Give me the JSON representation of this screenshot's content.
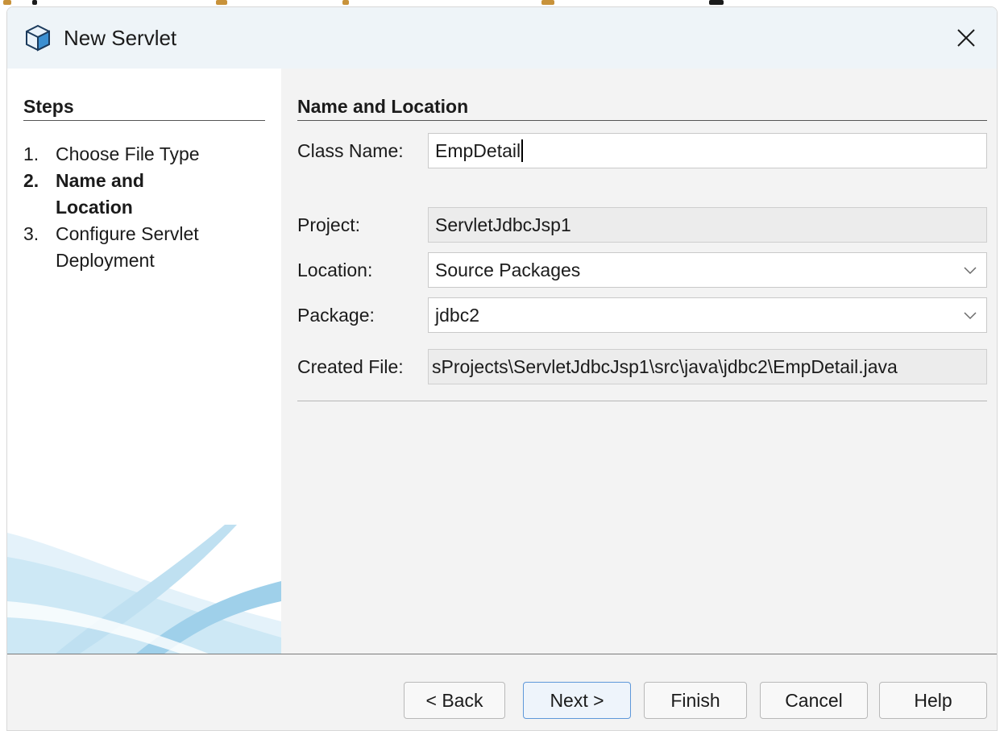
{
  "window": {
    "title": "New Servlet"
  },
  "steps": {
    "title": "Steps",
    "items": [
      {
        "num": "1.",
        "label": "Choose File Type",
        "active": false
      },
      {
        "num": "2.",
        "label": "Name and Location",
        "active": true
      },
      {
        "num": "3.",
        "label": "Configure Servlet Deployment",
        "active": false
      }
    ]
  },
  "panel": {
    "title": "Name and Location",
    "class_name": {
      "label": "Class Name:",
      "value": "EmpDetail"
    },
    "project": {
      "label": "Project:",
      "value": "ServletJdbcJsp1"
    },
    "location": {
      "label": "Location:",
      "value": "Source Packages"
    },
    "package": {
      "label": "Package:",
      "value": "jdbc2"
    },
    "created_file": {
      "label": "Created File:",
      "value": "sProjects\\ServletJdbcJsp1\\src\\java\\jdbc2\\EmpDetail.java"
    }
  },
  "buttons": {
    "back": "< Back",
    "next": "Next >",
    "finish": "Finish",
    "cancel": "Cancel",
    "help": "Help"
  },
  "icons": {
    "app": "cube-icon",
    "close": "close-icon",
    "dropdown": "chevron-down-icon"
  },
  "colors": {
    "titlebar": "#eef4f8",
    "panel_bg": "#f3f3f3",
    "default_button_border": "#5e98d9",
    "sidebar_art": "#9fd0ea"
  }
}
